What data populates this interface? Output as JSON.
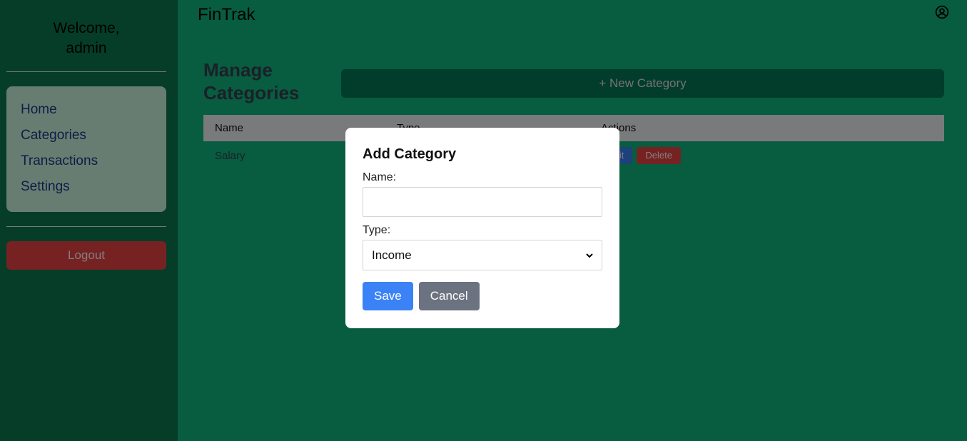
{
  "sidebar": {
    "welcome": "Welcome,",
    "username": "admin",
    "nav": [
      {
        "label": "Home"
      },
      {
        "label": "Categories"
      },
      {
        "label": "Transactions"
      },
      {
        "label": "Settings"
      }
    ],
    "logout_label": "Logout"
  },
  "header": {
    "app_title": "FinTrak",
    "user_icon": "user-circle-icon"
  },
  "main": {
    "page_title": "Manage Categories",
    "new_button_label": "+ New Category",
    "table": {
      "columns": [
        "Name",
        "Type",
        "Actions"
      ],
      "rows": [
        {
          "name": "Salary",
          "type": "",
          "edit_label": "Edit",
          "delete_label": "Delete"
        }
      ]
    }
  },
  "modal": {
    "title": "Add Category",
    "name_label": "Name:",
    "name_value": "",
    "type_label": "Type:",
    "type_value": "Income",
    "save_label": "Save",
    "cancel_label": "Cancel"
  },
  "colors": {
    "accent": "#10b981",
    "sidebar_bg": "#0a7a50",
    "logout": "#ef4444",
    "save": "#3b82f6",
    "cancel": "#6b7280"
  }
}
